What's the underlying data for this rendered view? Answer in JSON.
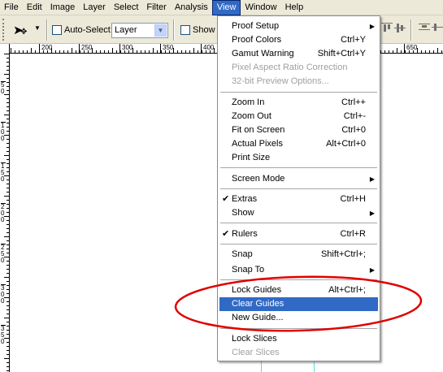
{
  "menubar": {
    "items": [
      "File",
      "Edit",
      "Image",
      "Layer",
      "Select",
      "Filter",
      "Analysis",
      "View",
      "Window",
      "Help"
    ],
    "active": "View"
  },
  "options": {
    "auto_select_label": "Auto-Select:",
    "auto_select_value": "Layer",
    "show_label": "Show"
  },
  "ruler": {
    "h_numbers": [
      "200",
      "250",
      "300",
      "350",
      "400",
      "650"
    ],
    "v_numbers": [
      "50",
      "100",
      "150",
      "200",
      "250",
      "300",
      "350"
    ]
  },
  "view_menu": {
    "items": [
      {
        "label": "Proof Setup",
        "shortcut": "",
        "submenu": true
      },
      {
        "label": "Proof Colors",
        "shortcut": "Ctrl+Y"
      },
      {
        "label": "Gamut Warning",
        "shortcut": "Shift+Ctrl+Y"
      },
      {
        "label": "Pixel Aspect Ratio Correction",
        "shortcut": "",
        "disabled": true
      },
      {
        "label": "32-bit Preview Options...",
        "shortcut": "",
        "disabled": true
      },
      {
        "label": "Zoom In",
        "shortcut": "Ctrl++"
      },
      {
        "label": "Zoom Out",
        "shortcut": "Ctrl+-"
      },
      {
        "label": "Fit on Screen",
        "shortcut": "Ctrl+0"
      },
      {
        "label": "Actual Pixels",
        "shortcut": "Alt+Ctrl+0"
      },
      {
        "label": "Print Size",
        "shortcut": ""
      },
      {
        "label": "Screen Mode",
        "shortcut": "",
        "submenu": true
      },
      {
        "label": "Extras",
        "shortcut": "Ctrl+H",
        "checked": true
      },
      {
        "label": "Show",
        "shortcut": "",
        "submenu": true
      },
      {
        "label": "Rulers",
        "shortcut": "Ctrl+R",
        "checked": true
      },
      {
        "label": "Snap",
        "shortcut": "Shift+Ctrl+;"
      },
      {
        "label": "Snap To",
        "shortcut": "",
        "submenu": true
      },
      {
        "label": "Lock Guides",
        "shortcut": "Alt+Ctrl+;"
      },
      {
        "label": "Clear Guides",
        "shortcut": "",
        "highlighted": true
      },
      {
        "label": "New Guide...",
        "shortcut": ""
      },
      {
        "label": "Lock Slices",
        "shortcut": ""
      },
      {
        "label": "Clear Slices",
        "shortcut": "",
        "disabled": true
      }
    ]
  },
  "colors": {
    "highlight": "#316ac5",
    "annotation_ellipse": "#e00000",
    "guide": "#5fd8f0"
  }
}
